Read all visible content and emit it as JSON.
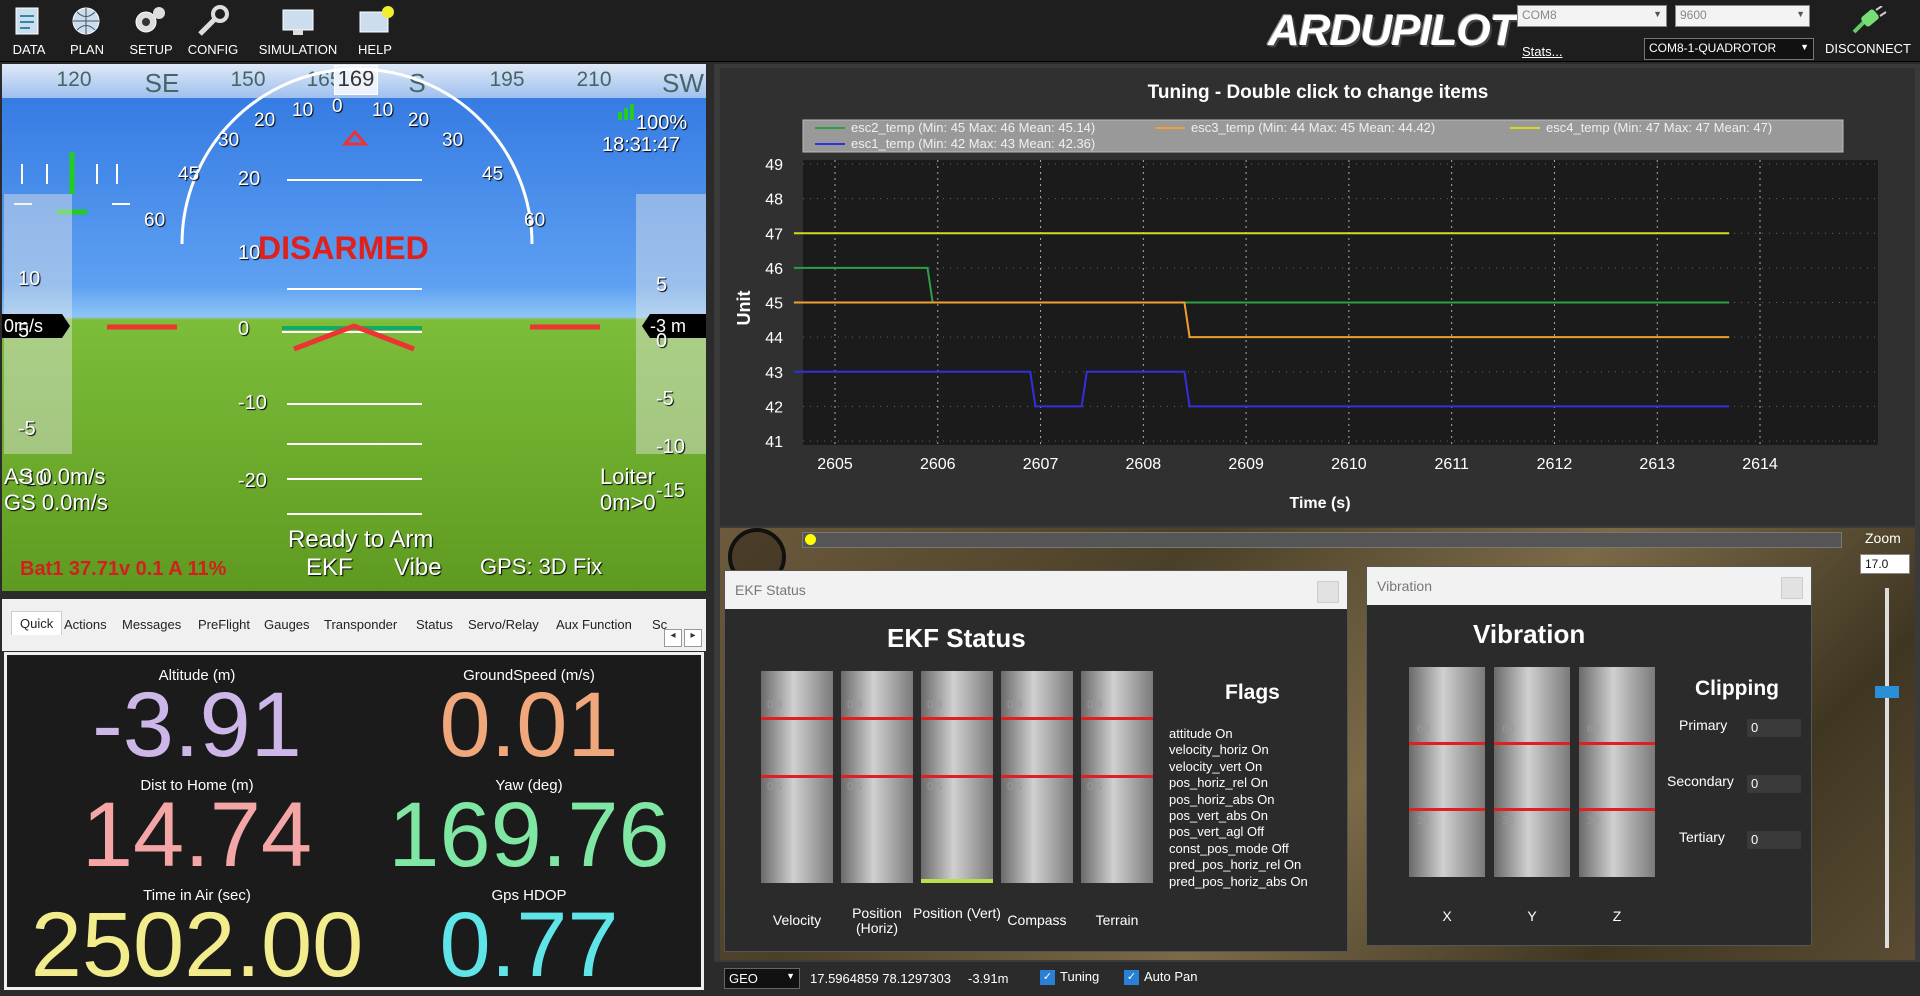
{
  "toolbar": {
    "items": [
      {
        "label": "DATA",
        "icon": "data-icon"
      },
      {
        "label": "PLAN",
        "icon": "globe-icon"
      },
      {
        "label": "SETUP",
        "icon": "gears-icon"
      },
      {
        "label": "CONFIG",
        "icon": "wrench-icon"
      },
      {
        "label": "SIMULATION",
        "icon": "monitor-icon"
      },
      {
        "label": "HELP",
        "icon": "help-monitor-icon"
      }
    ],
    "logo": "ARDUPILOT",
    "port": "COM8",
    "baud": "9600",
    "stats": "Stats...",
    "vehicle": "COM8-1-QUADROTOR",
    "disconnect": "DISCONNECT"
  },
  "hud": {
    "heading_ticks": [
      {
        "v": "120",
        "x": 72
      },
      {
        "v": "SE",
        "x": 160
      },
      {
        "v": "150",
        "x": 246
      },
      {
        "v": "165",
        "x": 322
      },
      {
        "v": "S",
        "x": 415
      },
      {
        "v": "195",
        "x": 505
      },
      {
        "v": "210",
        "x": 592
      },
      {
        "v": "SW",
        "x": 680
      }
    ],
    "heading_readout": "169",
    "armed": "DISARMED",
    "battery_pct": "100%",
    "time": "18:31:47",
    "speed_tape": [
      "10",
      "5",
      "-5",
      "-10"
    ],
    "speed_box": "0m/s",
    "alt_tape": [
      "5",
      "0",
      "-5",
      "-10",
      "-15"
    ],
    "alt_box": "-3 m",
    "roll_marks": [
      "60",
      "45",
      "30",
      "20",
      "10",
      "0",
      "10",
      "20",
      "30",
      "45",
      "60"
    ],
    "pitch_marks": [
      "20",
      "10",
      "0",
      "-10",
      "-20"
    ],
    "as": "AS 0.0m/s",
    "gs": "GS 0.0m/s",
    "mode": "Loiter",
    "home": "0m>0",
    "ready": "Ready to Arm",
    "ekf": "EKF",
    "vibe": "Vibe",
    "gps": "GPS: 3D Fix",
    "batt": "Bat1 37.71v 0.1 A 11%"
  },
  "tabs": {
    "items": [
      "Quick",
      "Actions",
      "Messages",
      "PreFlight",
      "Gauges",
      "Transponder",
      "Status",
      "Servo/Relay",
      "Aux Function",
      "Sc"
    ]
  },
  "quick": {
    "items": [
      {
        "label": "Altitude (m)",
        "value": "-3.91",
        "color": "#cdb7e8"
      },
      {
        "label": "GroundSpeed (m/s)",
        "value": "0.01",
        "color": "#f0a77c"
      },
      {
        "label": "Dist to Home (m)",
        "value": "14.74",
        "color": "#f4a6a6"
      },
      {
        "label": "Yaw (deg)",
        "value": "169.76",
        "color": "#7fe6a3"
      },
      {
        "label": "Time in Air (sec)",
        "value": "2502.00",
        "color": "#f3ec8c"
      },
      {
        "label": "Gps HDOP",
        "value": "0.77",
        "color": "#5fe4e8"
      }
    ]
  },
  "chart_data": {
    "type": "line",
    "title": "Tuning - Double click to change items",
    "xlabel": "Time (s)",
    "ylabel": "Unit",
    "xlim": [
      2604.5,
      2614.7
    ],
    "ylim": [
      41,
      49
    ],
    "xticks": [
      2605,
      2606,
      2607,
      2608,
      2609,
      2610,
      2611,
      2612,
      2613,
      2614
    ],
    "yticks": [
      41,
      42,
      43,
      44,
      45,
      46,
      47,
      48,
      49
    ],
    "series": [
      {
        "name": "esc2_temp (Min: 45 Max: 46 Mean: 45.14)",
        "color": "#2ea043",
        "x": [
          2604.6,
          2605.9,
          2605.95,
          2613.7
        ],
        "y": [
          46,
          46,
          45,
          45
        ]
      },
      {
        "name": "esc3_temp (Min: 44 Max: 45 Mean: 44.42)",
        "color": "#f0a030",
        "x": [
          2604.6,
          2608.4,
          2608.45,
          2613.7
        ],
        "y": [
          45,
          45,
          44,
          44
        ]
      },
      {
        "name": "esc4_temp (Min: 47 Max: 47 Mean: 47)",
        "color": "#d8d820",
        "x": [
          2604.6,
          2613.7
        ],
        "y": [
          47,
          47
        ]
      },
      {
        "name": "esc1_temp (Min: 42 Max: 43 Mean: 42.36)",
        "color": "#3030e0",
        "x": [
          2604.6,
          2606.9,
          2606.95,
          2607.4,
          2607.45,
          2608.4,
          2608.45,
          2613.7
        ],
        "y": [
          43,
          43,
          42,
          42,
          43,
          43,
          42,
          42
        ]
      }
    ]
  },
  "ekf": {
    "title_bar": "EKF Status",
    "title": "EKF Status",
    "bars": [
      {
        "label": "Velocity",
        "value": 0
      },
      {
        "label": "Position (Horiz)",
        "value": 0
      },
      {
        "label": "Position (Vert)",
        "value": 0.02
      },
      {
        "label": "Compass",
        "value": 0
      },
      {
        "label": "Terrain",
        "value": 0
      }
    ],
    "mark_high": "0.8",
    "mark_low": "0.5",
    "flags_title": "Flags",
    "flags": [
      "attitude On",
      "velocity_horiz On",
      "velocity_vert On",
      "pos_horiz_rel On",
      "pos_horiz_abs On",
      "pos_vert_abs On",
      "pos_vert_agl Off",
      "const_pos_mode Off",
      "pred_pos_horiz_rel On",
      "pred_pos_horiz_abs On"
    ]
  },
  "vibration": {
    "title_bar": "Vibration",
    "title": "Vibration",
    "axes": [
      "X",
      "Y",
      "Z"
    ],
    "mark_high": "60",
    "mark_low": "30",
    "clipping_title": "Clipping",
    "clipping": [
      {
        "label": "Primary",
        "value": "0"
      },
      {
        "label": "Secondary",
        "value": "0"
      },
      {
        "label": "Tertiary",
        "value": "0"
      }
    ]
  },
  "zoom": {
    "label": "Zoom",
    "value": "17.0"
  },
  "status": {
    "coord_type": "GEO",
    "coords": "17.5964859 78.1297303",
    "alt": "-3.91m",
    "tuning": "Tuning",
    "autopan": "Auto Pan"
  }
}
